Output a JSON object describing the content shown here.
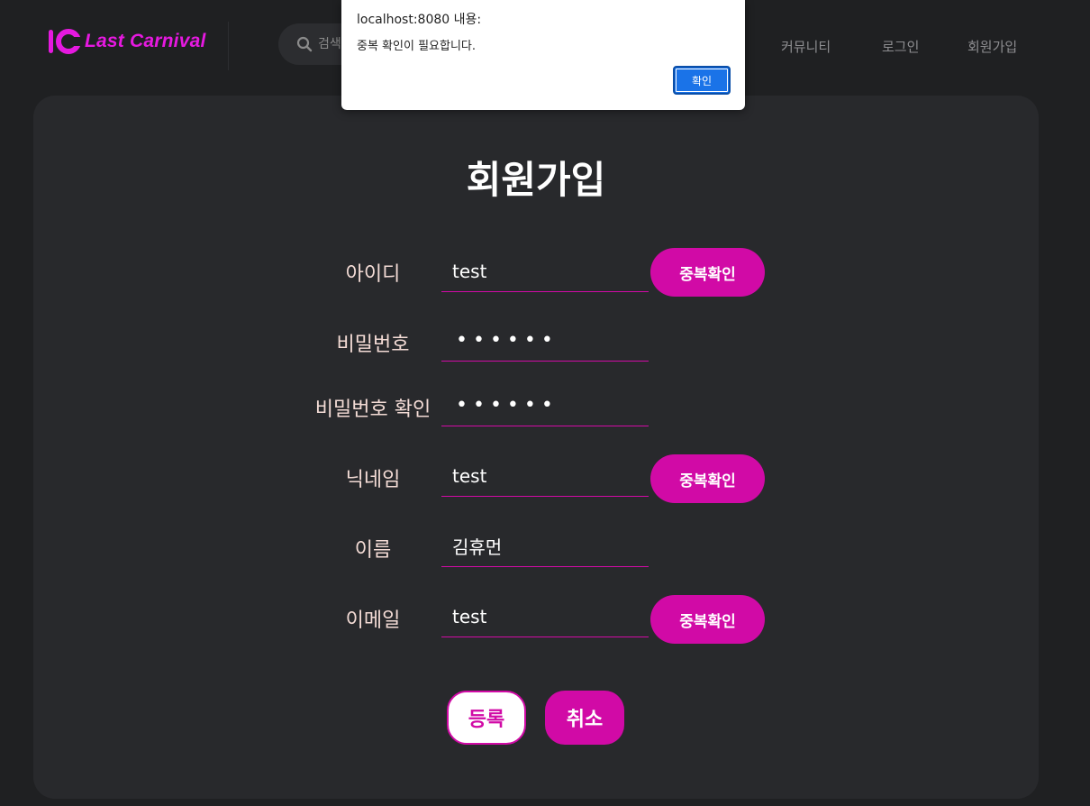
{
  "header": {
    "logo_text": "Last Carnival",
    "search_placeholder": "검색",
    "nav": [
      "커뮤니티",
      "로그인",
      "회원가입"
    ]
  },
  "form": {
    "title": "회원가입",
    "fields": [
      {
        "label": "아이디",
        "value": "test",
        "dup_button": "중복확인"
      },
      {
        "label": "비밀번호",
        "value": "••••••"
      },
      {
        "label": "비밀번호 확인",
        "value": "••••••"
      },
      {
        "label": "닉네임",
        "value": "test",
        "dup_button": "중복확인"
      },
      {
        "label": "이름",
        "value": "김휴먼"
      },
      {
        "label": "이메일",
        "value": "test",
        "dup_button": "중복확인"
      }
    ],
    "register_label": "등록",
    "cancel_label": "취소"
  },
  "dialog": {
    "origin": "localhost:8080 내용:",
    "message": "중복 확인이 필요합니다.",
    "ok_label": "확인"
  },
  "colors": {
    "accent": "#d10aa6",
    "logo": "#e619e0",
    "background": "#1f2022",
    "card": "#28292c",
    "dialog_button": "#1a73e8"
  }
}
